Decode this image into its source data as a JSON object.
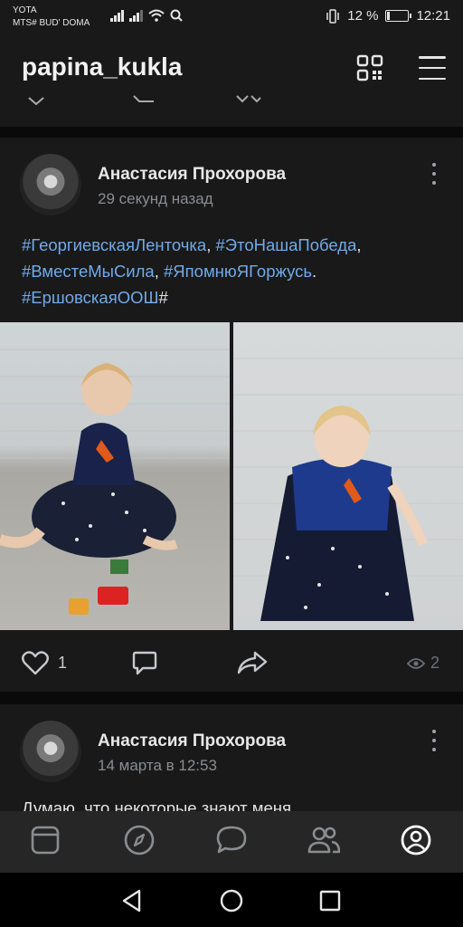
{
  "status_bar": {
    "carrier1": "YOTA",
    "carrier2": "MTS# BUD' DOMA",
    "battery": "12 %",
    "battery_level": 0.12,
    "time": "12:21"
  },
  "header": {
    "title": "papina_kukla"
  },
  "posts": [
    {
      "author": "Анастасия Прохорова",
      "time": "29 секунд назад",
      "hashtags": [
        "#ГеоргиевскаяЛенточка",
        "#ЭтоНашаПобеда",
        "#ВместеМыСила",
        "#ЯпомнюЯГоржусь",
        "#ЕршовскаяООШ"
      ],
      "sep1": ", ",
      "sep2": ",",
      "sep3": ", ",
      "sep4": ".",
      "trailing": "#",
      "likes": "1",
      "views": "2"
    },
    {
      "author": "Анастасия Прохорова",
      "time": "14 марта в 12:53",
      "text_partial": "Думаю, что некоторые знают меня"
    }
  ],
  "bottom_nav": {
    "items": [
      "feed-icon",
      "discover-icon",
      "messages-icon",
      "friends-icon",
      "profile-icon"
    ],
    "active": "profile-icon"
  },
  "colors": {
    "background": "#0a0a0a",
    "card": "#191919",
    "link": "#71aaeb",
    "text": "#e1e3e6",
    "secondary": "#8a8d91"
  }
}
